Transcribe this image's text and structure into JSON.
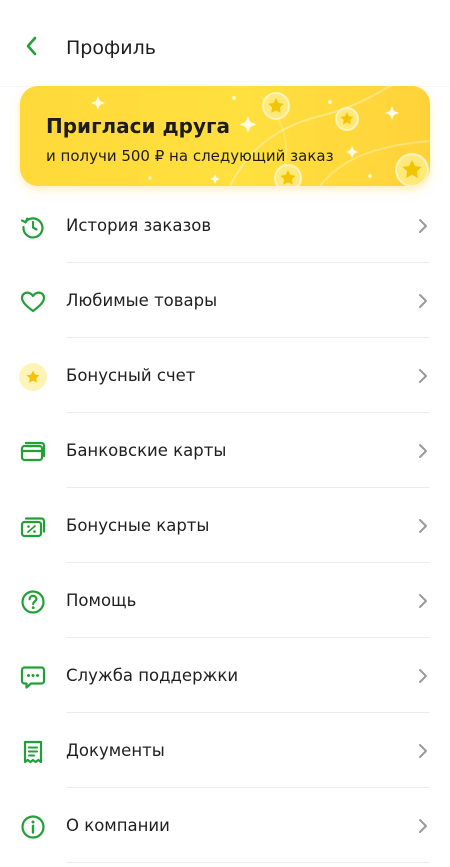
{
  "header": {
    "title": "Профиль",
    "back_icon": "chevron-left-icon"
  },
  "promo": {
    "title": "Пригласи друга",
    "subtitle": "и получи 500 ₽ на следующий заказ",
    "background_color": "#ffd93a"
  },
  "menu": {
    "items": [
      {
        "label": "История заказов",
        "icon": "history-icon"
      },
      {
        "label": "Любимые товары",
        "icon": "heart-icon"
      },
      {
        "label": "Бонусный счет",
        "icon": "star-coin-icon"
      },
      {
        "label": "Банковские карты",
        "icon": "bank-card-icon"
      },
      {
        "label": "Бонусные карты",
        "icon": "bonus-card-icon"
      },
      {
        "label": "Помощь",
        "icon": "question-icon"
      },
      {
        "label": "Служба поддержки",
        "icon": "chat-icon"
      },
      {
        "label": "Документы",
        "icon": "document-icon"
      },
      {
        "label": "О компании",
        "icon": "info-icon"
      }
    ]
  },
  "colors": {
    "accent": "#21a038",
    "chevron": "#9a9a9a",
    "divider": "#ececec",
    "star": "#f5c400"
  }
}
